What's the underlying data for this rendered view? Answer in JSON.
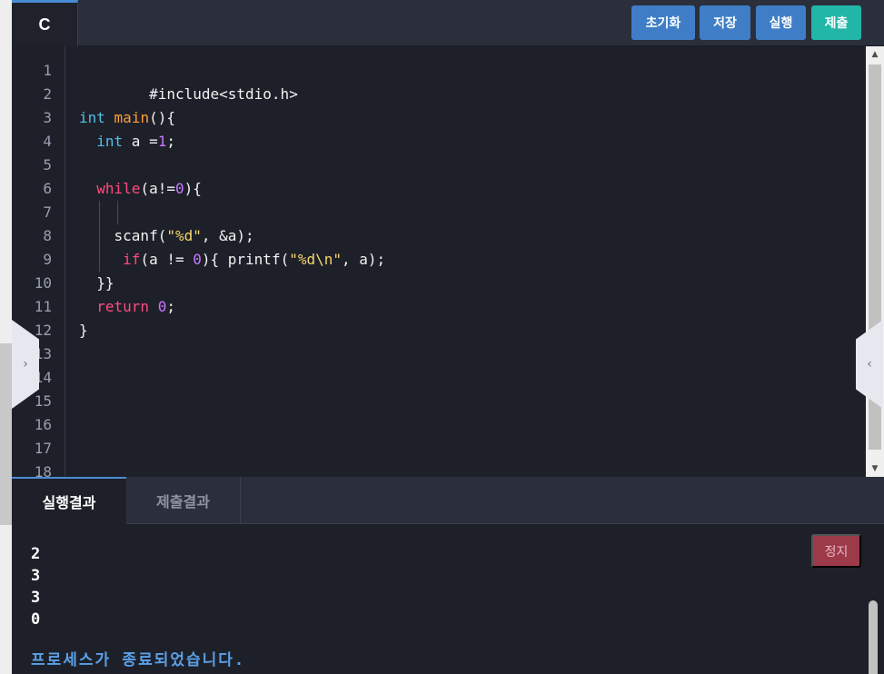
{
  "header": {
    "language_tab": "C",
    "buttons": {
      "reset": "초기화",
      "save": "저장",
      "run": "실행",
      "submit": "제출"
    }
  },
  "editor": {
    "line_numbers": [
      "1",
      "2",
      "3",
      "4",
      "5",
      "6",
      "7",
      "8",
      "9",
      "10",
      "11",
      "12",
      "13",
      "14",
      "15",
      "16",
      "17",
      "18"
    ],
    "lines": {
      "l1": "#include<stdio.h>",
      "l3": [
        "int",
        " ",
        "main",
        "(){"
      ],
      "l4": [
        "  ",
        "int",
        " a =",
        "1",
        ";"
      ],
      "l6": [
        "  ",
        "while",
        "(a!=",
        "0",
        "){"
      ],
      "l8": [
        "    scanf(",
        "\"%d\"",
        ", &a);"
      ],
      "l9": [
        "     ",
        "if",
        "(a != ",
        "0",
        "){ printf(",
        "\"%d\\n\"",
        ", a);"
      ],
      "l10": "  }}",
      "l11": [
        "  ",
        "return",
        " ",
        "0",
        ";"
      ],
      "l12": "}"
    }
  },
  "side_handles": {
    "left": "›",
    "right": "‹"
  },
  "results": {
    "tabs": {
      "run_result": "실행결과",
      "submit_result": "제출결과"
    },
    "stop_button": "정지",
    "output_lines": [
      "2",
      "3",
      "3",
      "0"
    ],
    "finished_message": "프로세스가 종료되었습니다."
  },
  "colors": {
    "accent_blue": "#3f7ec6",
    "submit_teal": "#21b6a8",
    "stop_red": "#9c3a4a",
    "keyword_type": "#4fc1e9",
    "keyword_control": "#ff4b7d",
    "function": "#ff9d3b",
    "number": "#c678ff",
    "string": "#f5d76e",
    "finished_message": "#5aa0e8"
  }
}
